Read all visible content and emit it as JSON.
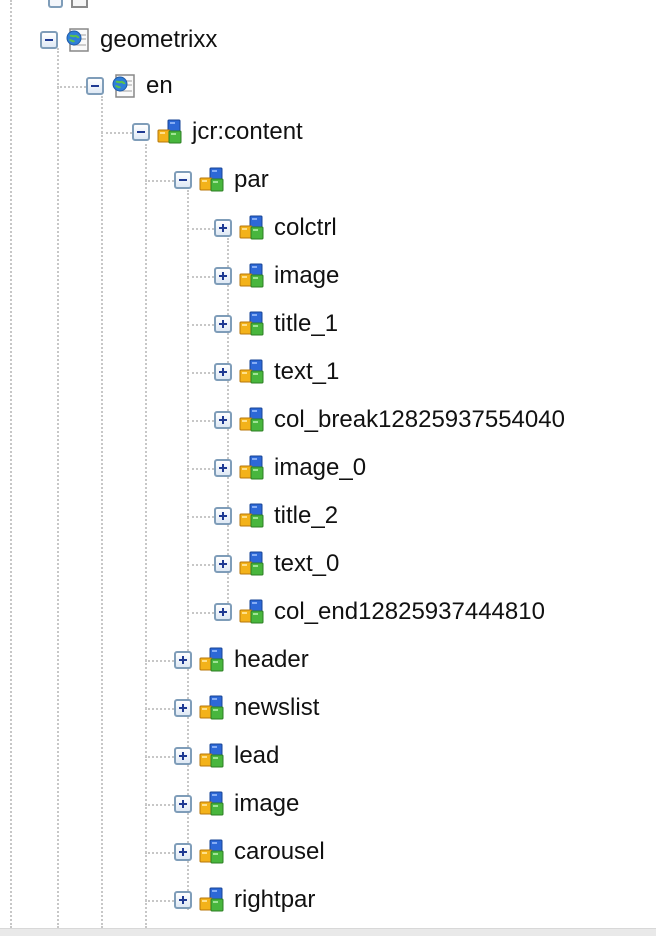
{
  "tree": {
    "nodes": [
      {
        "label": "geometrixx",
        "depth": 0,
        "toggle": "minus",
        "icon": "page-globe-icon"
      },
      {
        "label": "en",
        "depth": 1,
        "toggle": "minus",
        "icon": "page-globe-icon"
      },
      {
        "label": "jcr:content",
        "depth": 2,
        "toggle": "minus",
        "icon": "node-cubes-icon"
      },
      {
        "label": "par",
        "depth": 3,
        "toggle": "minus",
        "icon": "node-cubes-icon"
      },
      {
        "label": "colctrl",
        "depth": 4,
        "toggle": "plus",
        "icon": "node-cubes-icon"
      },
      {
        "label": "image",
        "depth": 4,
        "toggle": "plus",
        "icon": "node-cubes-icon"
      },
      {
        "label": "title_1",
        "depth": 4,
        "toggle": "plus",
        "icon": "node-cubes-icon"
      },
      {
        "label": "text_1",
        "depth": 4,
        "toggle": "plus",
        "icon": "node-cubes-icon"
      },
      {
        "label": "col_break12825937554040",
        "depth": 4,
        "toggle": "plus",
        "icon": "node-cubes-icon"
      },
      {
        "label": "image_0",
        "depth": 4,
        "toggle": "plus",
        "icon": "node-cubes-icon"
      },
      {
        "label": "title_2",
        "depth": 4,
        "toggle": "plus",
        "icon": "node-cubes-icon"
      },
      {
        "label": "text_0",
        "depth": 4,
        "toggle": "plus",
        "icon": "node-cubes-icon"
      },
      {
        "label": "col_end12825937444810",
        "depth": 4,
        "toggle": "plus",
        "icon": "node-cubes-icon"
      },
      {
        "label": "header",
        "depth": 3,
        "toggle": "plus",
        "icon": "node-cubes-icon"
      },
      {
        "label": "newslist",
        "depth": 3,
        "toggle": "plus",
        "icon": "node-cubes-icon"
      },
      {
        "label": "lead",
        "depth": 3,
        "toggle": "plus",
        "icon": "node-cubes-icon"
      },
      {
        "label": "image",
        "depth": 3,
        "toggle": "plus",
        "icon": "node-cubes-icon"
      },
      {
        "label": "carousel",
        "depth": 3,
        "toggle": "plus",
        "icon": "node-cubes-icon"
      },
      {
        "label": "rightpar",
        "depth": 3,
        "toggle": "plus",
        "icon": "node-cubes-icon"
      }
    ]
  },
  "colors": {
    "guide_line": "#c7c7c7",
    "toggle_border": "#7f9db9",
    "toggle_sign": "#1f3a93",
    "label_text": "#111111"
  }
}
